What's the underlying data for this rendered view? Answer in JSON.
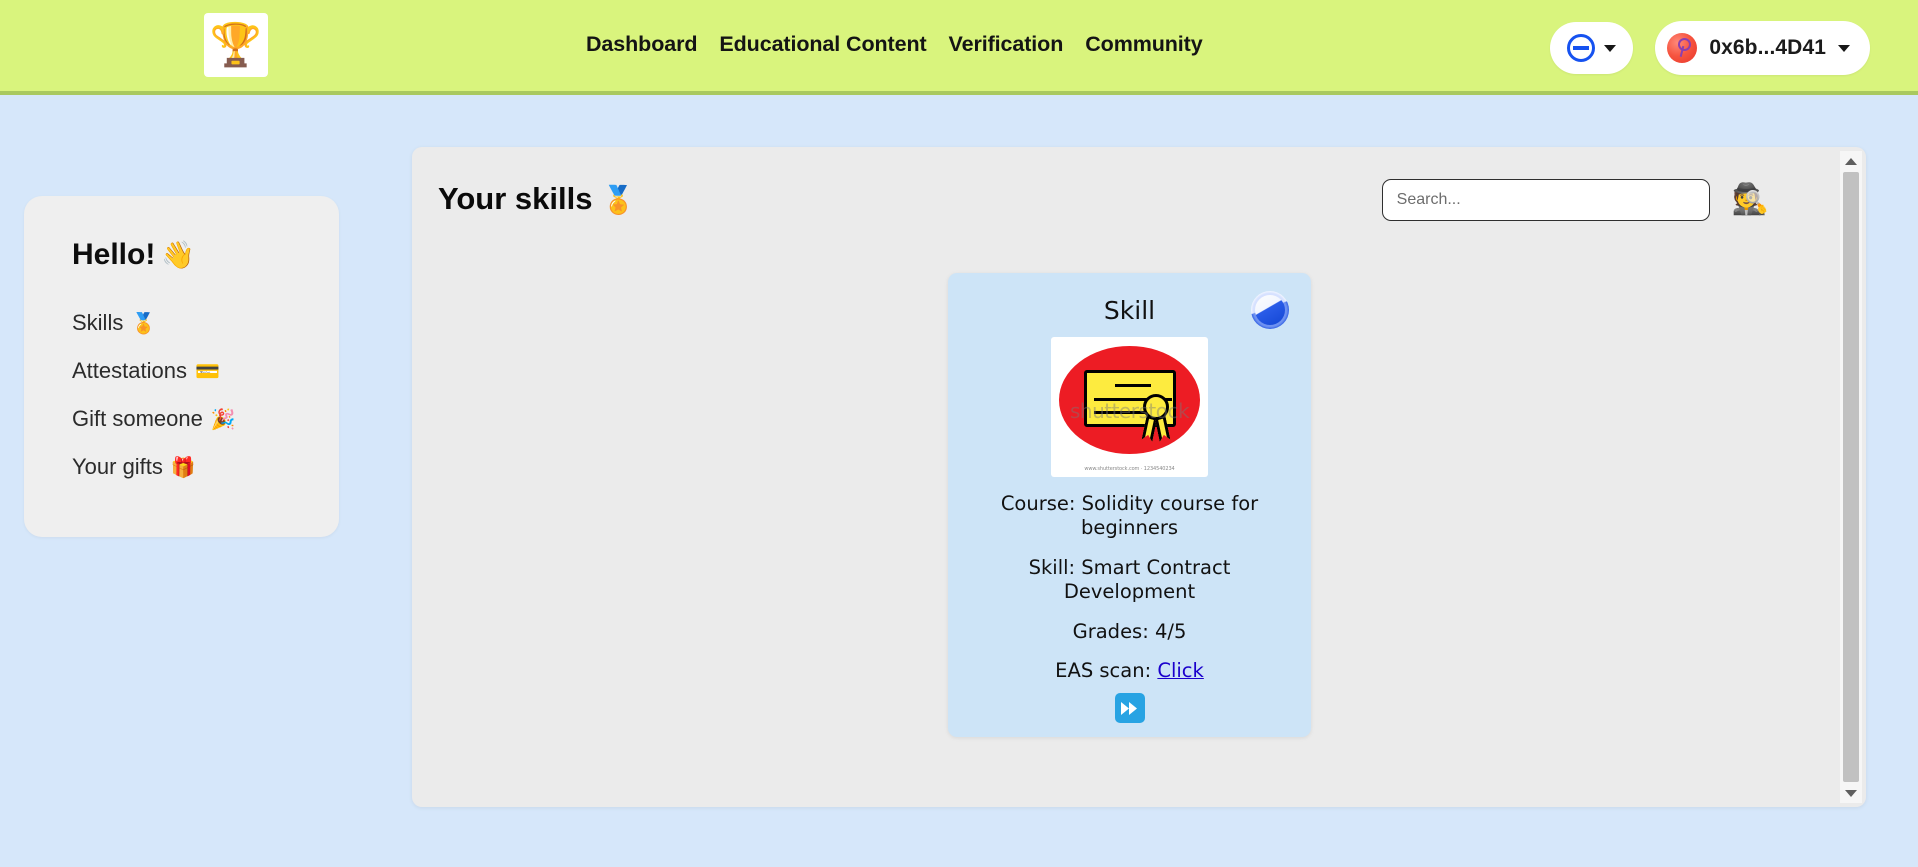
{
  "header": {
    "logo_icon": "trophy-icon",
    "logo_glyph": "🏆",
    "nav": [
      {
        "label": "Dashboard"
      },
      {
        "label": "Educational Content"
      },
      {
        "label": "Verification"
      },
      {
        "label": "Community"
      }
    ],
    "chain_selector": {
      "icon": "chain-circle-icon",
      "label": ""
    },
    "wallet": {
      "address": "0x6b...4D41",
      "avatar_icon": "wallet-avatar-icon"
    },
    "background_color": "#d9f47d",
    "border_color": "#a9c95f"
  },
  "sidebar": {
    "greeting": "Hello!",
    "greeting_emoji": "👋",
    "items": [
      {
        "label": "Skills",
        "emoji": "🏅"
      },
      {
        "label": "Attestations",
        "emoji": "💳"
      },
      {
        "label": "Gift someone",
        "emoji": "🎉"
      },
      {
        "label": "Your gifts",
        "emoji": "🎁"
      }
    ],
    "background_color": "#efefef"
  },
  "main": {
    "title": "Your skills",
    "title_emoji": "🏅",
    "search": {
      "value": "",
      "placeholder": "Search..."
    },
    "detective_emoji": "🕵️",
    "background_color": "#ebebeb",
    "cards": [
      {
        "title": "Skill",
        "badge_icon": "base-network-icon",
        "image": {
          "type": "certificate-image",
          "watermark": "shutterstock",
          "credit": "www.shutterstock.com · 1234540234"
        },
        "course_label": "Course: Solidity course for beginners",
        "skill_label": "Skill: Smart Contract Development",
        "grades_label": "Grades: 4/5",
        "eas_prefix": "EAS scan:",
        "eas_link": "Click",
        "expand_icon": "fast-forward-icon",
        "background_color": "#cde4f7"
      }
    ]
  },
  "scrollbar": {
    "up_icon": "scroll-up-arrow-icon",
    "down_icon": "scroll-down-arrow-icon"
  },
  "page": {
    "background_color": "#d6e7fa"
  }
}
